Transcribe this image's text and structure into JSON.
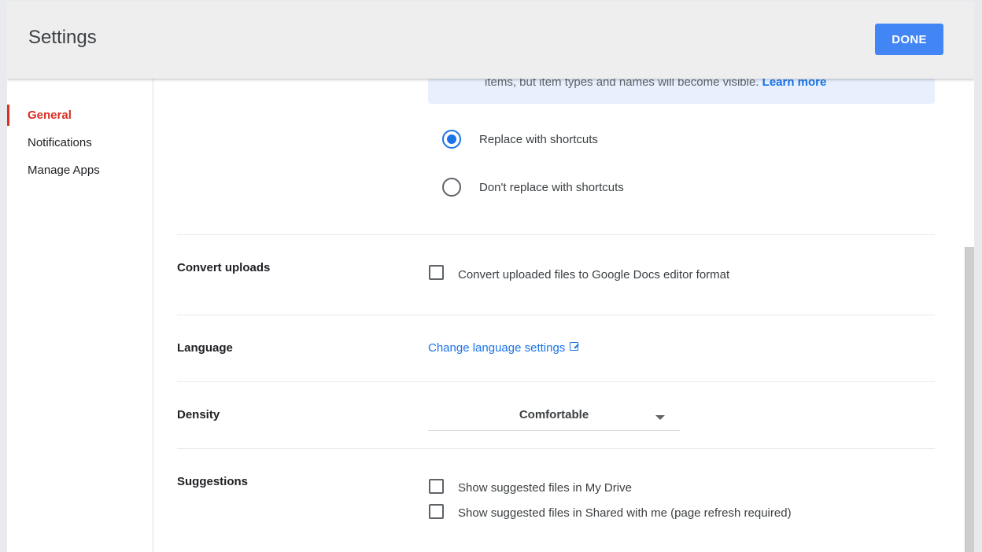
{
  "header": {
    "title": "Settings",
    "done_label": "DONE"
  },
  "sidebar": {
    "items": [
      {
        "label": "General",
        "active": true
      },
      {
        "label": "Notifications",
        "active": false
      },
      {
        "label": "Manage Apps",
        "active": false
      }
    ]
  },
  "shortcuts": {
    "info_text": "items, but item types and names will become visible.",
    "learn_more": "Learn more",
    "options": [
      {
        "label": "Replace with shortcuts",
        "selected": true
      },
      {
        "label": "Don't replace with shortcuts",
        "selected": false
      }
    ]
  },
  "convert_uploads": {
    "label": "Convert uploads",
    "checkbox_label": "Convert uploaded files to Google Docs editor format",
    "checked": false
  },
  "language": {
    "label": "Language",
    "link_text": "Change language settings",
    "link_icon": "open-in-new-icon"
  },
  "density": {
    "label": "Density",
    "selected": "Comfortable"
  },
  "suggestions": {
    "label": "Suggestions",
    "options": [
      {
        "label": "Show suggested files in My Drive",
        "checked": false
      },
      {
        "label": "Show suggested files in Shared with me (page refresh required)",
        "checked": false
      }
    ]
  },
  "colors": {
    "accent": "#4285f4",
    "active_nav": "#d93025",
    "link": "#1a73e8"
  }
}
